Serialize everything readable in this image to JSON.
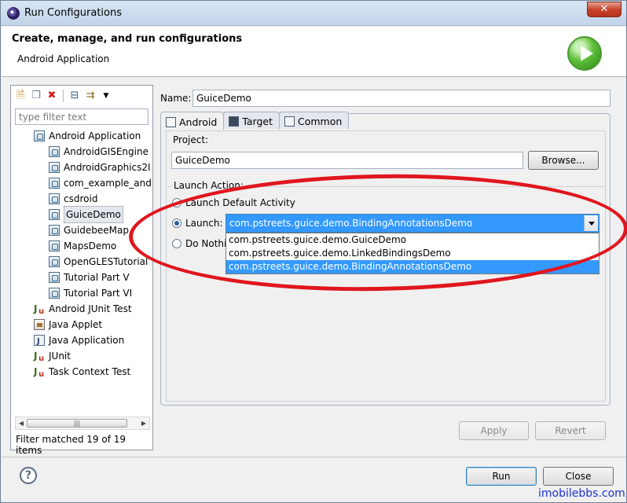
{
  "window": {
    "title": "Run Configurations",
    "close_glyph": "✕"
  },
  "header": {
    "title": "Create, manage, and run configurations",
    "subtitle": "Android Application"
  },
  "left_panel": {
    "filter_placeholder": "type filter text",
    "tree": [
      {
        "label": "Android Application",
        "icon": "android-launch-icon",
        "level": 1,
        "expanded": true
      },
      {
        "label": "AndroidGISEngine",
        "icon": "android-config-icon",
        "level": 2
      },
      {
        "label": "AndroidGraphics2I",
        "icon": "android-config-icon",
        "level": 2
      },
      {
        "label": "com_example_and",
        "icon": "android-config-icon",
        "level": 2
      },
      {
        "label": "csdroid",
        "icon": "android-config-icon",
        "level": 2
      },
      {
        "label": "GuiceDemo",
        "icon": "android-config-icon",
        "level": 2,
        "selected": true
      },
      {
        "label": "GuidebeeMap",
        "icon": "android-config-icon",
        "level": 2
      },
      {
        "label": "MapsDemo",
        "icon": "android-config-icon",
        "level": 2
      },
      {
        "label": "OpenGLESTutorial",
        "icon": "android-config-icon",
        "level": 2
      },
      {
        "label": "Tutorial Part V",
        "icon": "android-config-icon",
        "level": 2
      },
      {
        "label": "Tutorial Part VI",
        "icon": "android-config-icon",
        "level": 2
      },
      {
        "label": "Android JUnit Test",
        "icon": "junit-icon",
        "level": 1
      },
      {
        "label": "Java Applet",
        "icon": "applet-icon",
        "level": 1
      },
      {
        "label": "Java Application",
        "icon": "java-app-icon",
        "level": 1
      },
      {
        "label": "JUnit",
        "icon": "junit-icon",
        "level": 1
      },
      {
        "label": "Task Context Test",
        "icon": "junit-icon",
        "level": 1
      }
    ],
    "filter_status": "Filter matched 19 of 19 items"
  },
  "main": {
    "name_label": "Name:",
    "name_value": "GuiceDemo",
    "tabs": [
      {
        "label": "Android",
        "active": true
      },
      {
        "label": "Target",
        "active": false
      },
      {
        "label": "Common",
        "active": false
      }
    ],
    "project_label": "Project:",
    "project_value": "GuiceDemo",
    "browse_label": "Browse...",
    "launch_group_title": "Launch Action:",
    "radio_default": "Launch Default Activity",
    "radio_launch": "Launch:",
    "radio_nothing": "Do Nothing",
    "launch_selected": "com.pstreets.guice.demo.BindingAnnotationsDemo",
    "launch_options": [
      "com.pstreets.guice.demo.GuiceDemo",
      "com.pstreets.guice.demo.LinkedBindingsDemo",
      "com.pstreets.guice.demo.BindingAnnotationsDemo"
    ],
    "apply_label": "Apply",
    "revert_label": "Revert"
  },
  "footer": {
    "help_glyph": "?",
    "run_label": "Run",
    "close_label": "Close"
  },
  "watermark": "imobilebbs.com",
  "colors": {
    "selection": "#3399ff",
    "annotation": "#e0161e",
    "watermark": "#1e2fd6"
  }
}
